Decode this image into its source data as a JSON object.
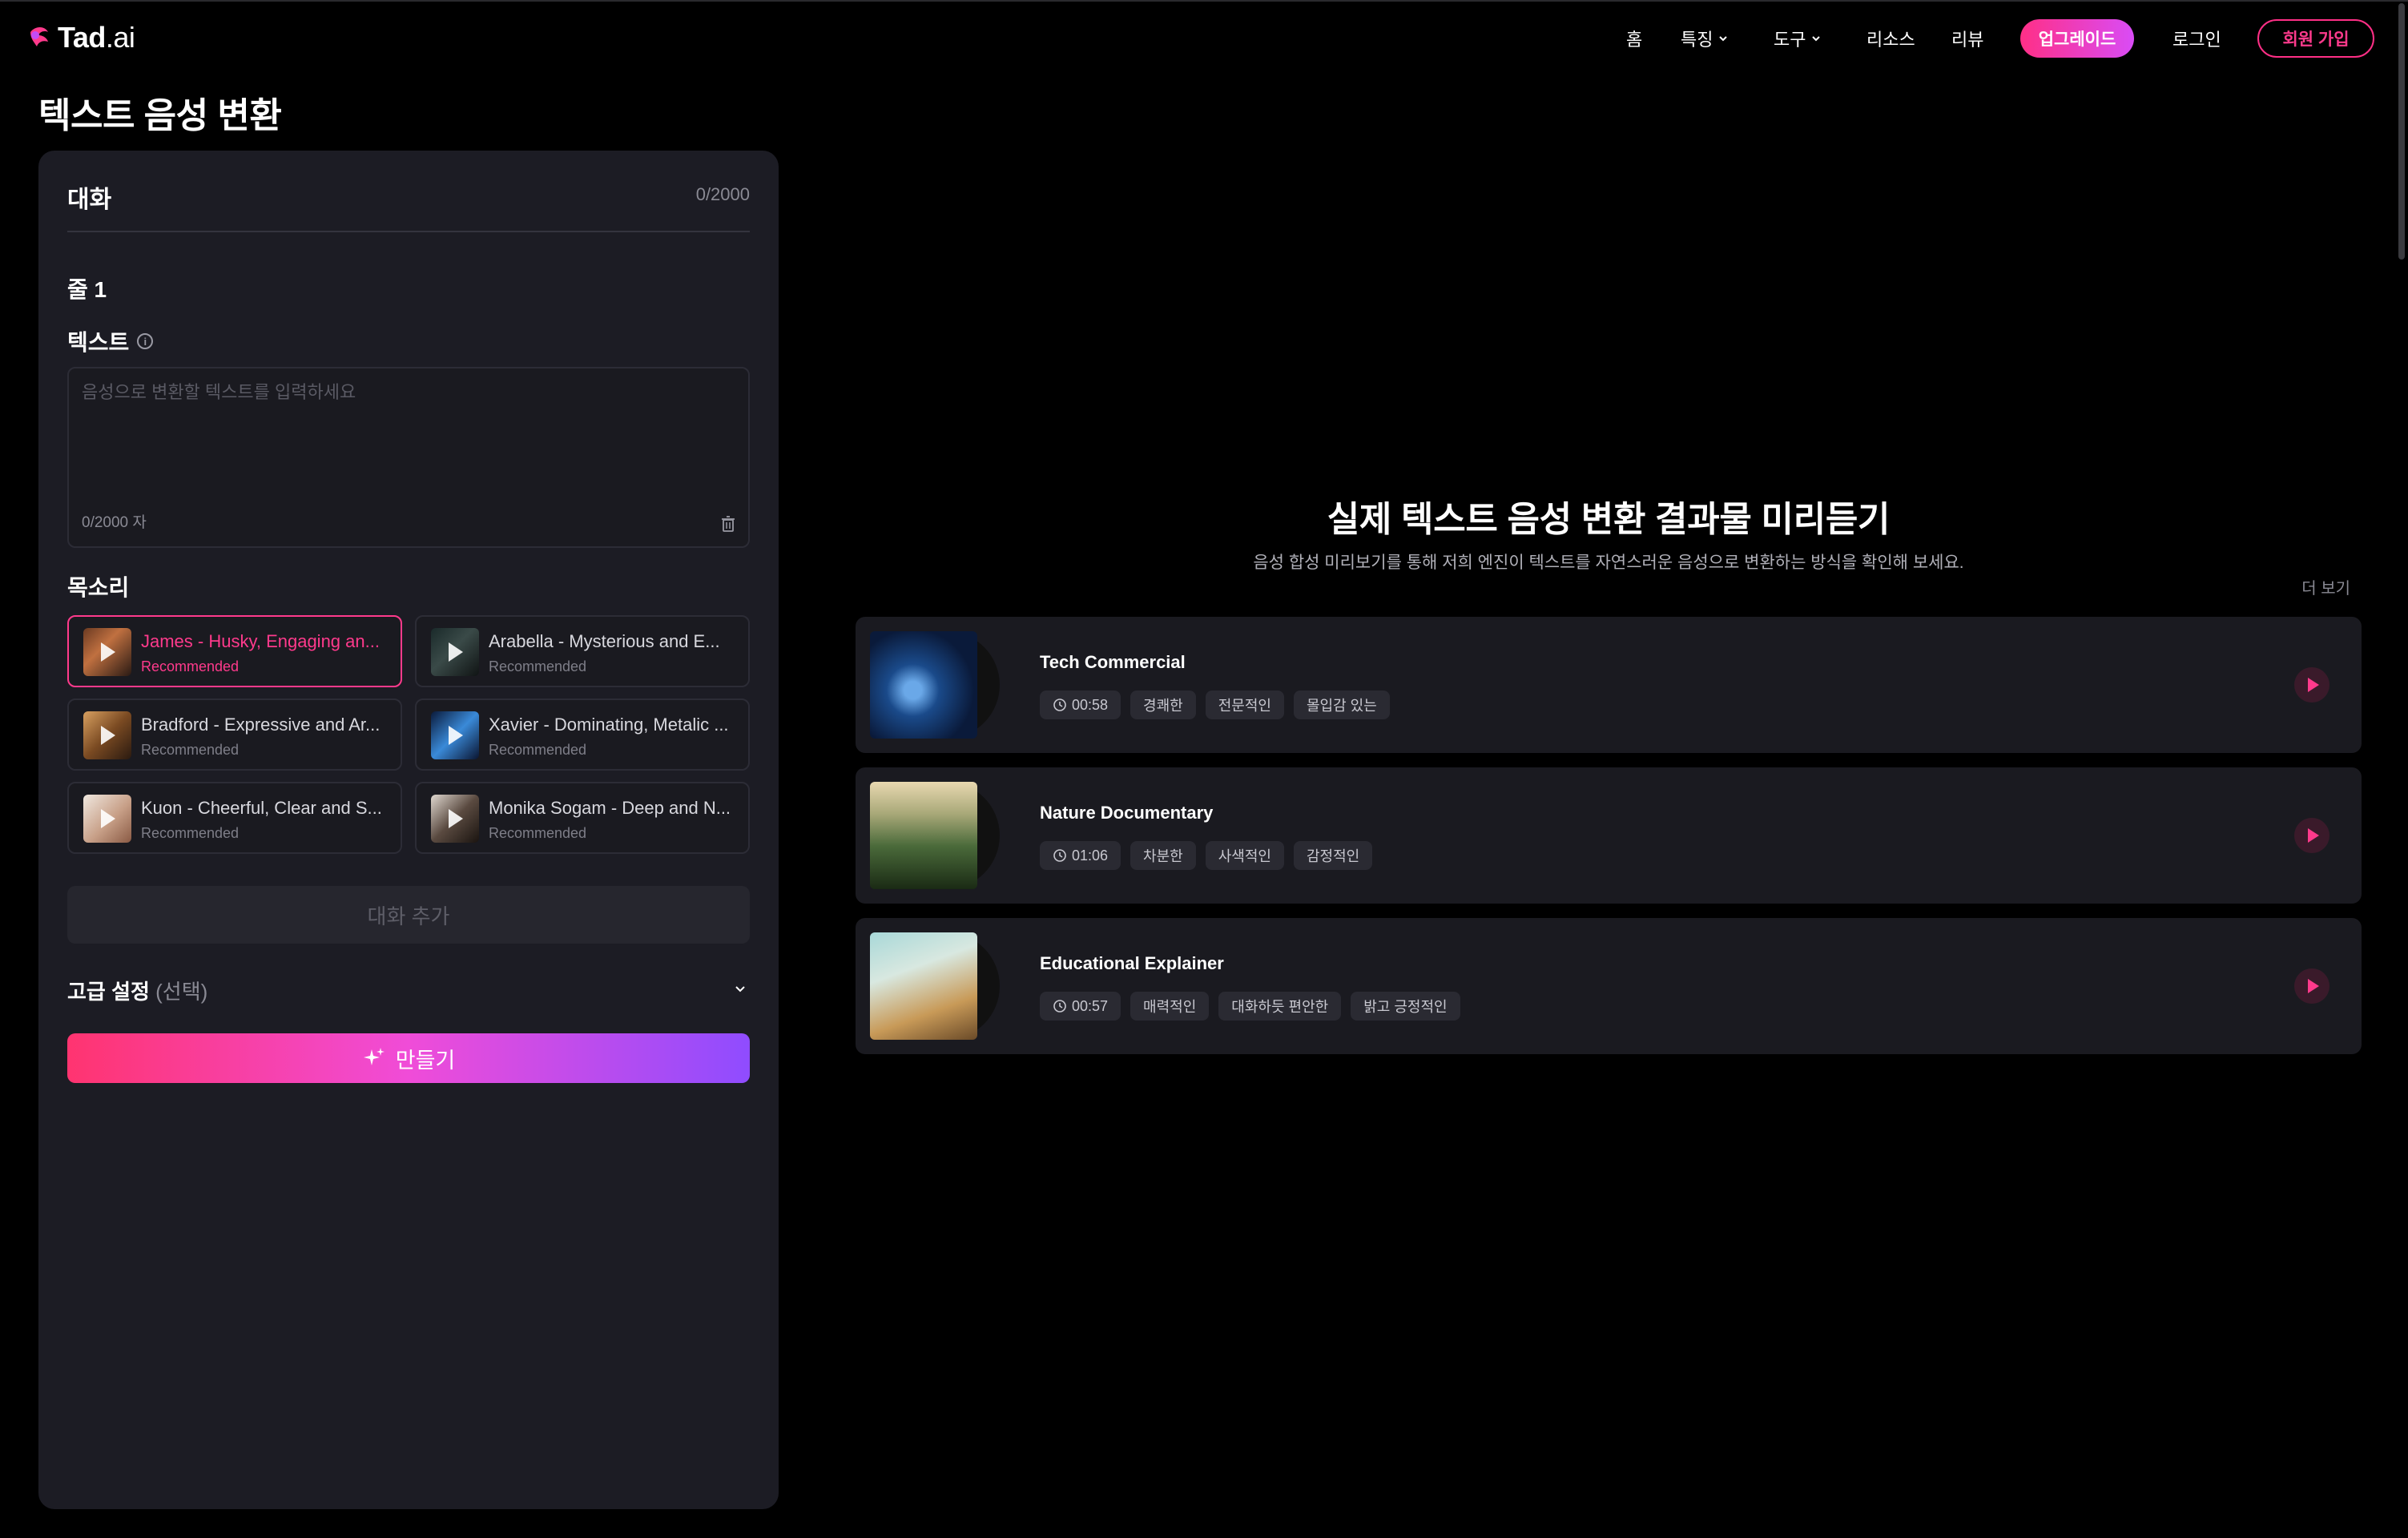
{
  "header": {
    "logo_main": "Tad",
    "logo_suffix": ".ai",
    "nav": {
      "home": "홈",
      "features": "특징",
      "tools": "도구",
      "resources": "리소스",
      "reviews": "리뷰"
    },
    "upgrade": "업그레이드",
    "login": "로그인",
    "signup": "회원 가입"
  },
  "page_title": "텍스트 음성 변환",
  "dialog": {
    "title": "대화",
    "count": "0/2000",
    "line_label": "줄 1",
    "text_label": "텍스트",
    "placeholder": "음성으로 변환할 텍스트를 입력하세요",
    "char_count": "0/2000 자",
    "voice_label": "목소리",
    "more": "더 보기",
    "voices": [
      {
        "name": "James - Husky, Engaging an...",
        "tag": "Recommended",
        "active": true
      },
      {
        "name": "Arabella - Mysterious and E...",
        "tag": "Recommended",
        "active": false
      },
      {
        "name": "Bradford - Expressive and Ar...",
        "tag": "Recommended",
        "active": false
      },
      {
        "name": "Xavier - Dominating, Metalic ...",
        "tag": "Recommended",
        "active": false
      },
      {
        "name": "Kuon - Cheerful, Clear and S...",
        "tag": "Recommended",
        "active": false
      },
      {
        "name": "Monika Sogam - Deep and N...",
        "tag": "Recommended",
        "active": false
      }
    ],
    "add_button": "대화 추가",
    "advanced": "고급 설정",
    "advanced_optional": "(선택)",
    "make_button": "만들기"
  },
  "preview": {
    "title": "실제 텍스트 음성 변환 결과물 미리듣기",
    "subtitle": "음성 합성 미리보기를 통해 저희 엔진이 텍스트를 자연스러운 음성으로 변환하는 방식을 확인해 보세요.",
    "items": [
      {
        "title": "Tech Commercial",
        "duration": "00:58",
        "tags": [
          "경쾌한",
          "전문적인",
          "몰입감 있는"
        ]
      },
      {
        "title": "Nature Documentary",
        "duration": "01:06",
        "tags": [
          "차분한",
          "사색적인",
          "감정적인"
        ]
      },
      {
        "title": "Educational Explainer",
        "duration": "00:57",
        "tags": [
          "매력적인",
          "대화하듯 편안한",
          "밝고 긍정적인"
        ]
      }
    ]
  },
  "colors": {
    "accent": "#ff3a8c",
    "background": "#000000",
    "panel": "#1c1c24"
  }
}
